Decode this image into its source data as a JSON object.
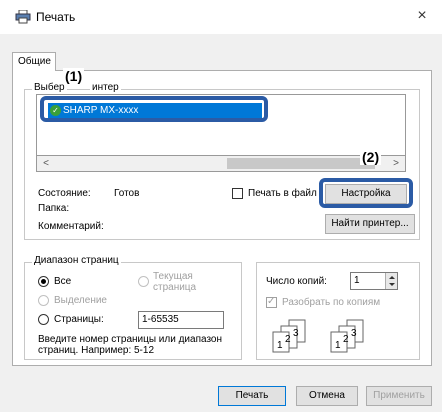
{
  "window": {
    "title": "Печать",
    "close_glyph": "×",
    "icon": "printer-icon"
  },
  "tabs": [
    {
      "label": "Общие"
    }
  ],
  "printer_group": {
    "label_start": "Выбер",
    "label_end": "интер",
    "selected_printer": "SHARP MX-xxxx",
    "scroll_left": "<",
    "scroll_right": ">"
  },
  "callouts": {
    "one": "(1)",
    "two": "(2)"
  },
  "status": {
    "state_label": "Состояние:",
    "state_value": "Готов",
    "location_label": "Папка:",
    "comment_label": "Комментарий:",
    "print_to_file": "Печать в файл",
    "setup_button": "Настройка",
    "find_printer_button": "Найти принтер..."
  },
  "page_range": {
    "label": "Диапазон страниц",
    "all": "Все",
    "current_page": "Текущая",
    "current_page_2": "страница",
    "selection": "Выделение",
    "pages": "Страницы:",
    "pages_value": "1-65535",
    "hint_line1": "Введите номер страницы или диапазон",
    "hint_line2": "страниц.  Например: 5-12"
  },
  "copies": {
    "label": "Число копий:",
    "value": "1",
    "collate": "Разобрать по копиям",
    "collate_digits": [
      "1",
      "2",
      "3"
    ]
  },
  "footer": {
    "print_button": "Печать",
    "cancel_button": "Отмена",
    "apply_button": "Применить"
  },
  "colors": {
    "accent": "#2b5ba5",
    "selection": "#0078d7",
    "ready_icon": "#3aa03a"
  }
}
